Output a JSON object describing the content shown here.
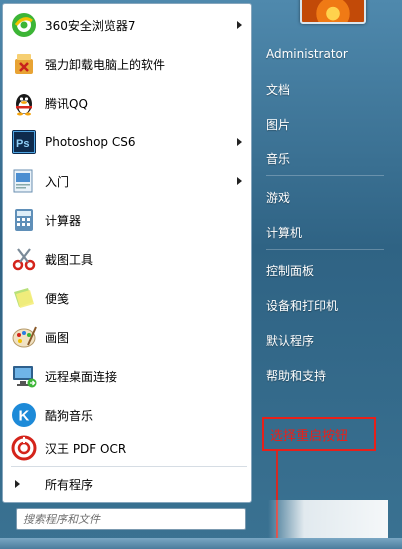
{
  "programs": [
    {
      "label": "360安全浏览器7",
      "icon": "browser-360-icon",
      "has_submenu": true
    },
    {
      "label": "强力卸载电脑上的软件",
      "icon": "uninstall-icon",
      "has_submenu": false
    },
    {
      "label": "腾讯QQ",
      "icon": "qq-penguin-icon",
      "has_submenu": false
    },
    {
      "label": "Photoshop CS6",
      "icon": "photoshop-icon",
      "has_submenu": true
    },
    {
      "label": "入门",
      "icon": "getting-started-icon",
      "has_submenu": true
    },
    {
      "label": "计算器",
      "icon": "calculator-icon",
      "has_submenu": false
    },
    {
      "label": "截图工具",
      "icon": "snipping-tool-icon",
      "has_submenu": false
    },
    {
      "label": "便笺",
      "icon": "sticky-notes-icon",
      "has_submenu": false
    },
    {
      "label": "画图",
      "icon": "paint-icon",
      "has_submenu": false
    },
    {
      "label": "远程桌面连接",
      "icon": "remote-desktop-icon",
      "has_submenu": false
    },
    {
      "label": "酷狗音乐",
      "icon": "kugou-music-icon",
      "has_submenu": false
    },
    {
      "label": "汉王 PDF OCR",
      "icon": "hanwang-ocr-icon",
      "has_submenu": false
    }
  ],
  "all_programs_label": "所有程序",
  "search": {
    "placeholder": "搜索程序和文件"
  },
  "right_menu": [
    {
      "label": "Administrator"
    },
    {
      "label": "文档"
    },
    {
      "label": "图片"
    },
    {
      "label": "音乐"
    },
    {
      "label": "游戏"
    },
    {
      "label": "计算机"
    },
    {
      "label": "控制面板"
    },
    {
      "label": "设备和打印机"
    },
    {
      "label": "默认程序"
    },
    {
      "label": "帮助和支持"
    }
  ],
  "annotation": {
    "label": "选择重启按钮"
  },
  "colors": {
    "annotation": "#e8201a",
    "menu_blue": "#2f6384"
  }
}
